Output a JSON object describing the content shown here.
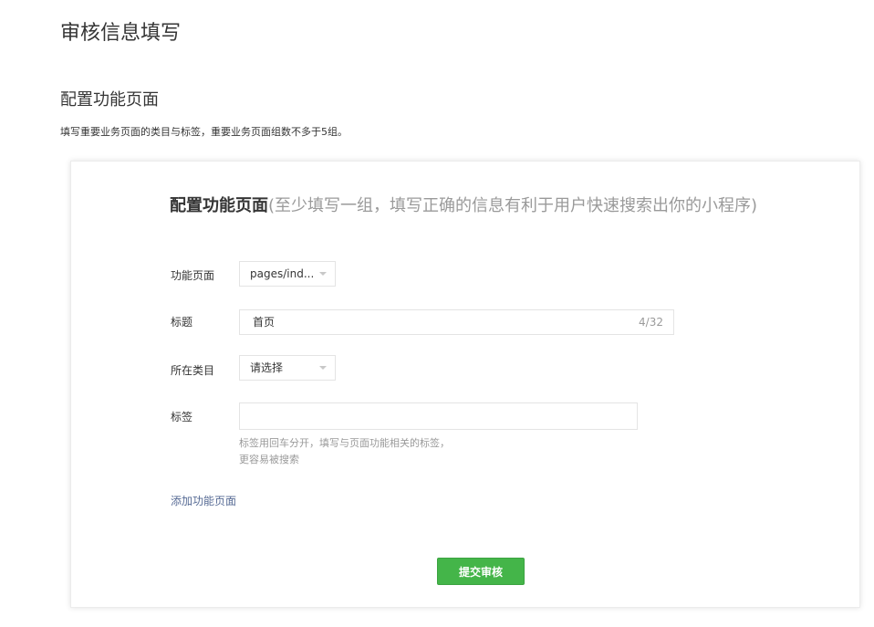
{
  "page_title": "审核信息填写",
  "section": {
    "title": "配置功能页面",
    "description": "填写重要业务页面的类目与标签，重要业务页面组数不多于5组。"
  },
  "card": {
    "title_main": "配置功能页面",
    "title_sub": "(至少填写一组，填写正确的信息有利于用户快速搜索出你的小程序)",
    "fields": {
      "page": {
        "label": "功能页面",
        "value": "pages/ind..."
      },
      "title": {
        "label": "标题",
        "value": "首页",
        "counter": "4/32"
      },
      "category": {
        "label": "所在类目",
        "value": "请选择"
      },
      "tags": {
        "label": "标签",
        "value": "",
        "hint_line1": "标签用回车分开，填写与页面功能相关的标签，",
        "hint_line2": "更容易被搜索"
      }
    },
    "add_link": "添加功能页面",
    "submit": "提交审核"
  },
  "colors": {
    "primary_green": "#44b549",
    "link_blue": "#576b95",
    "text": "#353535",
    "muted": "#9a9a9a",
    "border": "#e4e4e4"
  }
}
